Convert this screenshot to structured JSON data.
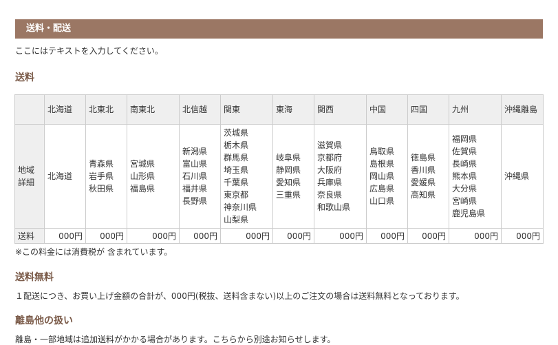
{
  "header": {
    "title": "送料・配送"
  },
  "intro": "ここにはテキストを入力してください。",
  "shipping": {
    "heading": "送料",
    "corner": "",
    "row_labels": {
      "detail": "地域詳細",
      "fee": "送料"
    },
    "regions": [
      {
        "name": "北海道",
        "prefectures": [
          "北海道"
        ],
        "fee": "000円"
      },
      {
        "name": "北東北",
        "prefectures": [
          "青森県",
          "岩手県",
          "秋田県"
        ],
        "fee": "000円"
      },
      {
        "name": "南東北",
        "prefectures": [
          "宮城県",
          "山形県",
          "福島県"
        ],
        "fee": "000円"
      },
      {
        "name": "北信越",
        "prefectures": [
          "新潟県",
          "富山県",
          "石川県",
          "福井県",
          "長野県"
        ],
        "fee": "000円"
      },
      {
        "name": "関東",
        "prefectures": [
          "茨城県",
          "栃木県",
          "群馬県",
          "埼玉県",
          "千葉県",
          "東京都",
          "神奈川県",
          "山梨県"
        ],
        "fee": "000円"
      },
      {
        "name": "東海",
        "prefectures": [
          "岐阜県",
          "静岡県",
          "愛知県",
          "三重県"
        ],
        "fee": "000円"
      },
      {
        "name": "関西",
        "prefectures": [
          "滋賀県",
          "京都府",
          "大阪府",
          "兵庫県",
          "奈良県",
          "和歌山県"
        ],
        "fee": "000円"
      },
      {
        "name": "中国",
        "prefectures": [
          "鳥取県",
          "島根県",
          "岡山県",
          "広島県",
          "山口県"
        ],
        "fee": "000円"
      },
      {
        "name": "四国",
        "prefectures": [
          "徳島県",
          "香川県",
          "愛媛県",
          "高知県"
        ],
        "fee": "000円"
      },
      {
        "name": "九州",
        "prefectures": [
          "福岡県",
          "佐賀県",
          "長崎県",
          "熊本県",
          "大分県",
          "宮崎県",
          "鹿児島県"
        ],
        "fee": "000円"
      },
      {
        "name": "沖縄離島",
        "prefectures": [
          "沖縄県"
        ],
        "fee": "000円"
      }
    ],
    "tax_note": "※この料金には消費税が 含まれています。"
  },
  "free_shipping": {
    "heading": "送料無料",
    "text": "１配送につき、お買い上げ金額の合計が、000円(税抜、送料含まない)以上のご注文の場合は送料無料となっております。"
  },
  "islands": {
    "heading": "離島他の扱い",
    "text": "離島・一部地域は追加送料がかかる場合があります。こちらから別途お知らせします。"
  },
  "colors": {
    "header_bg": "#9b7764",
    "heading_text": "#7a5a48",
    "table_header_bg": "#efefef",
    "border": "#cccccc"
  }
}
